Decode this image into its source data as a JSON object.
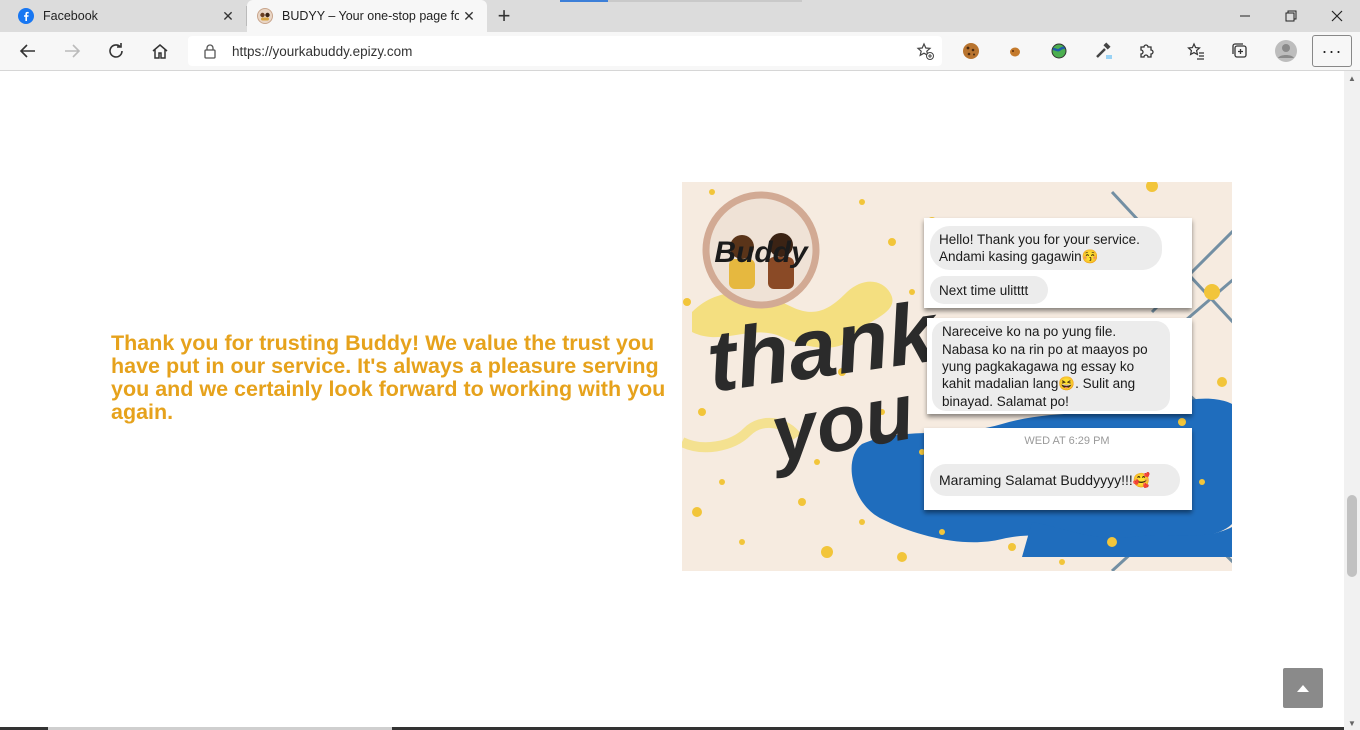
{
  "browser": {
    "tabs": [
      {
        "title": "Facebook",
        "active": false,
        "icon": "facebook-icon"
      },
      {
        "title": "BUDYY – Your one-stop page for",
        "active": true,
        "icon": "buddy-favicon-icon"
      }
    ],
    "address_bar": {
      "url": "https://yourkabuddy.epizy.com"
    }
  },
  "page": {
    "thank_you_message": "Thank you for trusting Buddy! We value the trust you have put in our service. It's always a pleasure serving you and we certainly look forward to working with you again.",
    "feedback_image": {
      "logo_text": "Buddy",
      "script_text_1": "thank",
      "script_text_2": "you",
      "chat1_line1": "Hello! Thank you for your service.",
      "chat1_line2": "Andami kasing gagawin😚",
      "chat1_reply": "Next time ulitttt",
      "chat2_line1": "Nareceive ko na po yung file.",
      "chat2_line2": "Nabasa ko na rin po at maayos po",
      "chat2_line3": "yung pagkakagawa ng essay ko",
      "chat2_line4": "kahit madalian lang😆. Sulit ang",
      "chat2_line5": "binayad. Salamat po!",
      "chat3_timestamp": "WED AT 6:29 PM",
      "chat3_message": "Maraming Salamat Buddyyyy!!!🥰"
    }
  },
  "colors": {
    "accent": "#e6a21c",
    "blue_splash": "#1f6dbd",
    "card_bg": "#f6ebe0"
  }
}
